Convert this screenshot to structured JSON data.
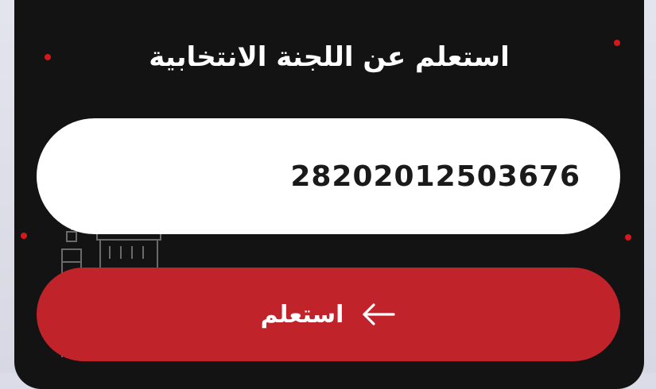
{
  "form": {
    "title": "استعلم عن اللجنة الانتخابية",
    "national_id_value": "28202012503676"
  },
  "submit": {
    "label": "استعلم",
    "icon": "arrow-left-icon"
  },
  "colors": {
    "card_bg": "#141313",
    "accent": "#c1232b",
    "dot": "#d5171e",
    "input_bg": "#ffffff",
    "page_bg": "#dcdce8"
  }
}
